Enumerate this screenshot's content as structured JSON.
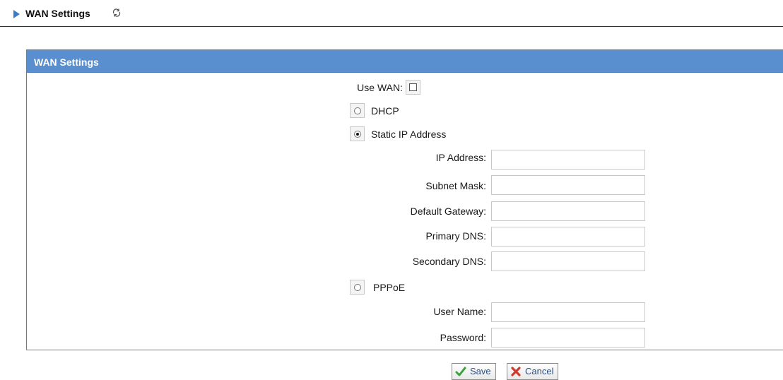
{
  "page": {
    "title": "WAN Settings",
    "icons": {
      "nav": "triangle-right-icon",
      "refresh": "refresh-icon"
    }
  },
  "panel": {
    "title": "WAN Settings"
  },
  "form": {
    "use_wan_label": "Use WAN:",
    "use_wan_checked": false,
    "connection_types": [
      {
        "label": "DHCP",
        "selected": false
      },
      {
        "label": "Static IP Address",
        "selected": true
      },
      {
        "label": "PPPoE",
        "selected": false
      }
    ],
    "static_fields": [
      {
        "label": "IP Address:",
        "value": ""
      },
      {
        "label": "Subnet Mask:",
        "value": ""
      },
      {
        "label": "Default Gateway:",
        "value": ""
      },
      {
        "label": "Primary DNS:",
        "value": ""
      },
      {
        "label": "Secondary DNS:",
        "value": ""
      }
    ],
    "pppoe_fields": [
      {
        "label": "User Name:",
        "value": ""
      },
      {
        "label": "Password:",
        "value": ""
      }
    ]
  },
  "actions": {
    "save_label": "Save",
    "cancel_label": "Cancel",
    "save_icon": "checkmark-icon",
    "cancel_icon": "x-icon"
  },
  "colors": {
    "panel_header_bg": "#5a8fcf",
    "nav_arrow": "#3a7cc8",
    "save_icon": "#3aa33a",
    "cancel_icon": "#d03a2a",
    "button_text": "#2a4f86"
  }
}
